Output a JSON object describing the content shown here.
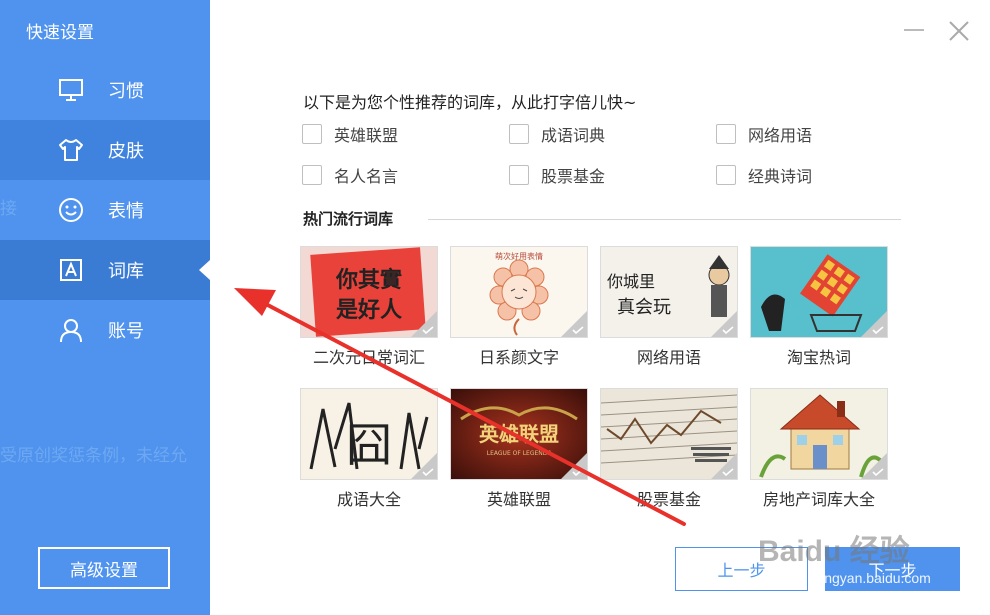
{
  "sidebar": {
    "title": "快速设置",
    "items": [
      {
        "label": "习惯",
        "icon": "monitor-icon"
      },
      {
        "label": "皮肤",
        "icon": "tshirt-icon"
      },
      {
        "label": "表情",
        "icon": "smiley-icon"
      },
      {
        "label": "词库",
        "icon": "font-a-icon",
        "active": true
      },
      {
        "label": "账号",
        "icon": "user-icon"
      }
    ],
    "advanced_button": "高级设置",
    "ghost_text_1": "接",
    "ghost_text_2": "受原创奖惩条例，未经允"
  },
  "main": {
    "heading": "以下是为您个性推荐的词库，从此打字倍儿快~",
    "checkboxes": [
      "英雄联盟",
      "成语词典",
      "网络用语",
      "名人名言",
      "股票基金",
      "经典诗词"
    ],
    "section_title": "热门流行词库",
    "cards": [
      {
        "label": "二次元日常词汇",
        "image_text": "你其實是好人"
      },
      {
        "label": "日系颜文字",
        "image_text": "萌次好用表情"
      },
      {
        "label": "网络用语",
        "image_text": "你城里真会玩"
      },
      {
        "label": "淘宝热词"
      },
      {
        "label": "成语大全",
        "image_text": "囧"
      },
      {
        "label": "英雄联盟",
        "image_text": "英雄联盟",
        "image_subtext": "LEAGUE OF LEGENDS"
      },
      {
        "label": "股票基金"
      },
      {
        "label": "房地产词库大全"
      }
    ]
  },
  "footer": {
    "prev_button": "上一步",
    "next_button": "下一步",
    "watermark": "Baidu 经验",
    "watermark_url": "jingyan.baidu.com"
  },
  "colors": {
    "sidebar_bg": "#4f93ee",
    "sidebar_active": "#3a7bd4",
    "accent": "#4f93ee",
    "arrow": "#e8312b"
  }
}
